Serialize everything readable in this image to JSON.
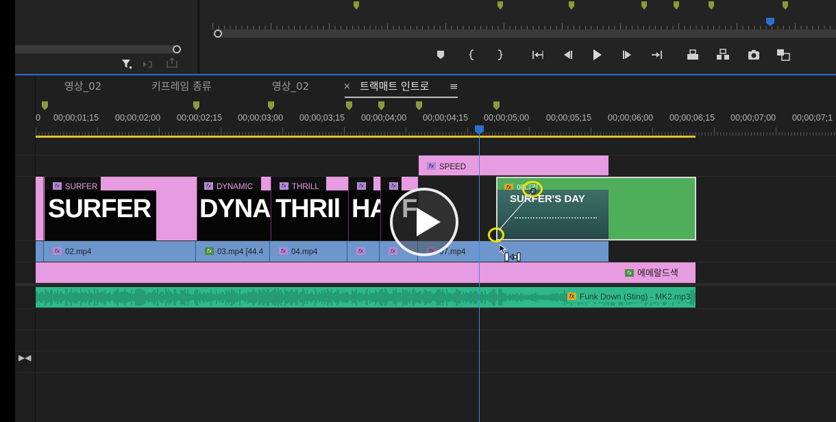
{
  "timeline": {
    "tabs": [
      {
        "label": "영상_02",
        "active": false
      },
      {
        "label": "키프레임 종류",
        "active": false
      },
      {
        "label": "영상_02",
        "active": false
      },
      {
        "label": "트랙매트 인트로",
        "active": true
      }
    ],
    "tab_close": "×",
    "tab_menu": "≡",
    "timecodes": [
      "0",
      "00;00;01;15",
      "00;00;02;00",
      "00;00;02;15",
      "00;00;03;00",
      "00;00;03;15",
      "00;00;04;00",
      "00;00;04;15",
      "00;00;05;00",
      "00;00;05;15",
      "00;00;06;00",
      "00;00;06;15",
      "00;00;07;00",
      "00;00;07;1"
    ]
  },
  "clips": {
    "speed": "SPEED",
    "fx_titles": [
      {
        "label": "SURFER",
        "big": "SURFER"
      },
      {
        "label": "DYNAMIC",
        "big": "DYNAI"
      },
      {
        "label": "THRILL",
        "big": "THRIl"
      },
      {
        "label": "",
        "big": "HA"
      },
      {
        "label": "",
        "big": "F"
      }
    ],
    "green_clip_label": "에디컷",
    "green_clip_thumb_text": "SURFER'S DAY",
    "videos": [
      "02.mp4",
      "03.mp4 [44.4",
      "04.mp4",
      "",
      "",
      "07.mp4"
    ],
    "emerald": "에메랄드색",
    "audio": "Funk Down (Sting) - MK2.mp3",
    "fx_glyph": "fx"
  },
  "colors": {
    "accent_blue": "#2d6fcf",
    "clip_pink": "#e79be0",
    "clip_blue": "#6d96cc",
    "clip_green": "#4fae5a",
    "audio_green": "#2fb98a",
    "marker": "#8a9a3a",
    "workarea": "#e2c22a",
    "annotation": "#f0e000"
  },
  "icons": {
    "program_controls": [
      "marker-icon",
      "mark-in-icon",
      "mark-out-icon",
      "go-to-in-icon",
      "step-back-icon",
      "play-icon",
      "step-forward-icon",
      "go-to-out-icon",
      "lift-icon",
      "extract-icon",
      "export-frame-icon",
      "compare-icon"
    ],
    "source_controls": [
      "filter-icon",
      "insert-icon",
      "overwrite-icon"
    ]
  }
}
